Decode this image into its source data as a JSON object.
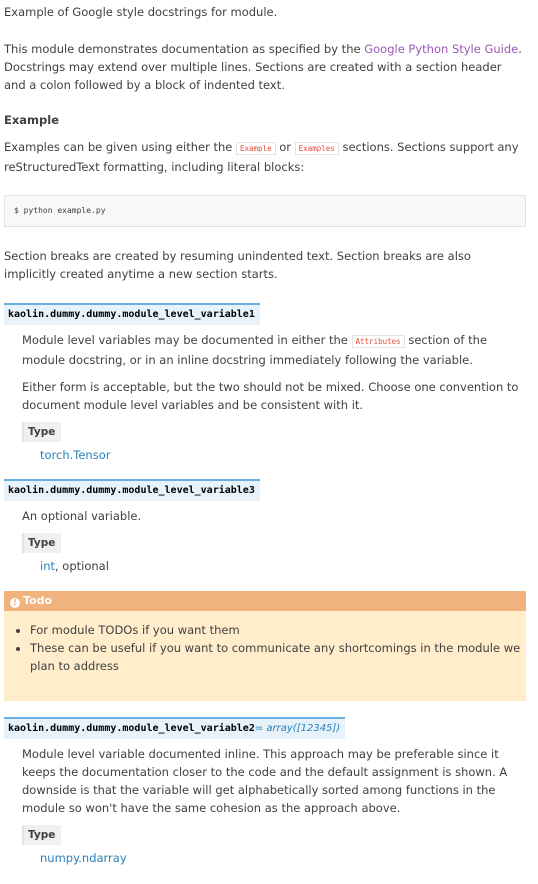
{
  "intro": "Example of Google style docstrings for module.",
  "para1_prefix": "This module demonstrates documentation as specified by the ",
  "para1_link": "Google Python Style Guide",
  "para1_suffix": ". Docstrings may extend over multiple lines. Sections are created with a section header and a colon followed by a block of indented text.",
  "example_heading": "Example",
  "para2_a": "Examples can be given using either the ",
  "para2_code1": "Example",
  "para2_or": " or ",
  "para2_code2": "Examples",
  "para2_b": " sections. Sections support any reStructuredText formatting, including literal blocks:",
  "code": "$ python example.py",
  "para3": "Section breaks are created by resuming unindented text. Section breaks are also implicitly created anytime a new section starts.",
  "var1": {
    "sig": "kaolin.dummy.dummy.module_level_variable1",
    "desc_a": "Module level variables may be documented in either the ",
    "desc_code": "Attributes",
    "desc_b": " section of the module docstring, or in an inline docstring immediately following the variable.",
    "desc2": "Either form is acceptable, but the two should not be mixed. Choose one convention to document module level variables and be consistent with it.",
    "type_label": "Type",
    "type_value": "torch.Tensor"
  },
  "var3": {
    "sig": "kaolin.dummy.dummy.module_level_variable3",
    "desc": "An optional variable.",
    "type_label": "Type",
    "type_link": "int",
    "type_rest": ", optional"
  },
  "todo": {
    "title": "Todo",
    "items": [
      "For module TODOs if you want them",
      "These can be useful if you want to communicate any shortcomings in the module we plan to address"
    ]
  },
  "var2": {
    "sig": "kaolin.dummy.dummy.module_level_variable2",
    "value": "= array([12345])",
    "desc": "Module level variable documented inline. This approach may be preferable since it keeps the documentation closer to the code and the default assignment is shown. A downside is that the variable will get alphabetically sorted among functions in the module so won't have the same cohesion as the approach above.",
    "type_label": "Type",
    "type_value": "numpy.ndarray"
  }
}
